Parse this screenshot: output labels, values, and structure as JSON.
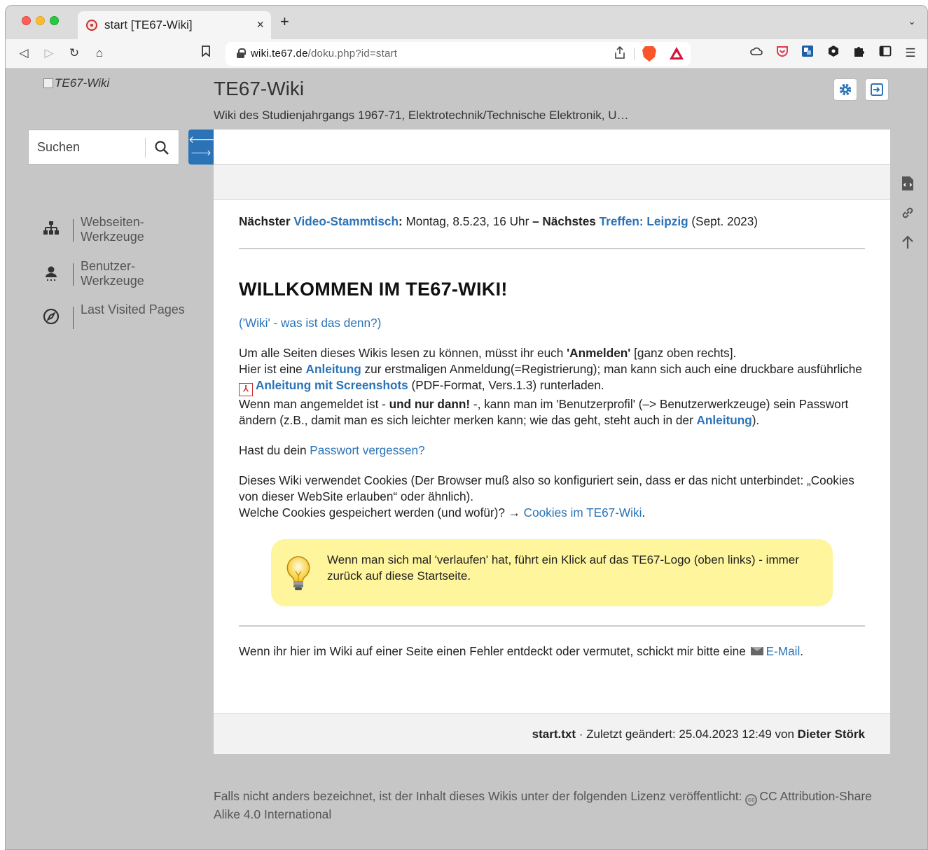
{
  "browser": {
    "tab": {
      "title": "start [TE67-Wiki]",
      "close": "×"
    },
    "new_tab": "+",
    "tab_overflow": "⌄",
    "url": {
      "host": "wiki.te67.de",
      "path": "/doku.php?id=start"
    },
    "icons": [
      "back-icon",
      "forward-icon",
      "reload-icon",
      "home-icon",
      "bookmark-icon",
      "share-icon",
      "brave-shields-icon",
      "brave-rewards-icon",
      "cloud-icon",
      "pocket-icon",
      "extension-icon",
      "puzzle-icon",
      "sidebar-icon",
      "menu-icon"
    ]
  },
  "site": {
    "logo_alt": "TE67-Wiki",
    "title": "TE67-Wiki",
    "tagline": "Wiki des Studienjahrgangs 1967-71, Elektrotechnik/Technische Elektronik, U…"
  },
  "search": {
    "placeholder": "Suchen"
  },
  "sidebar": {
    "items": [
      {
        "label": "Webseiten-Werkzeuge",
        "icon": "sitemap-icon"
      },
      {
        "label": "Benutzer-Werkzeuge",
        "icon": "user-icon"
      },
      {
        "label": "Last Visited Pages",
        "icon": "compass-icon"
      }
    ]
  },
  "news": {
    "b1": "Nächster ",
    "link1": "Video-Stammtisch",
    "b2": ":",
    "t1": " Montag, 8.5.23, 16 Uhr ",
    "b3": "– Nächstes ",
    "link2": "Treffen: Leipzig",
    "t2": " (Sept. 2023)"
  },
  "article": {
    "heading": "WILLKOMMEN IM TE67-WIKI!",
    "wiki_link": "('Wiki' - was ist das denn?)",
    "p1_a": "Um alle Seiten dieses Wikis lesen zu können, müsst ihr euch ",
    "p1_b": "'Anmelden'",
    "p1_c": " [ganz oben rechts].",
    "p1_d": "Hier ist eine ",
    "p1_link1": "Anleitung",
    "p1_e": " zur erstmaligen Anmeldung(=Registrierung); man kann sich auch eine druckbare ausführliche ",
    "p1_pdf": "Anleitung mit Screenshots",
    "p1_f": " (PDF-Format, Vers.1.3) runterladen.",
    "p1_g": "Wenn man angemeldet ist - ",
    "p1_h": "und nur dann!",
    "p1_i": " -, kann man im 'Benutzerprofil' (–> Benutzerwerkzeuge) sein Passwort ändern (z.B., damit man es sich leichter merken kann; wie das geht, steht auch in der ",
    "p1_link2": "Anleitung",
    "p1_j": ").",
    "p2_a": "Hast du dein ",
    "p2_link": "Passwort vergessen?",
    "p3_a": "Dieses Wiki verwendet Cookies (Der Browser muß also so konfiguriert sein, dass er das nicht unterbindet: „Cookies von dieser WebSite erlauben“ oder ähnlich).",
    "p3_b": "Welche Cookies gespeichert werden (und wofür)? → ",
    "p3_link": "Cookies im TE67-Wiki",
    "p3_c": ".",
    "note": "Wenn man sich mal 'verlaufen' hat, führt ein Klick auf das TE67-Logo (oben links) - immer zurück auf diese Startseite.",
    "p4_a": "Wenn ihr hier im Wiki auf einer Seite einen Fehler entdeckt oder vermutet, schickt mir bitte eine ",
    "p4_link": "E-Mail",
    "p4_b": "."
  },
  "footer": {
    "file": "start.txt",
    "changed": " · Zuletzt geändert: 25.04.2023 12:49 von ",
    "author": "Dieter Störk"
  },
  "license": {
    "text": "Falls nicht anders bezeichnet, ist der Inhalt dieses Wikis unter der folgenden Lizenz veröffentlicht: ",
    "link": "CC Attribution-Share Alike 4.0 International"
  },
  "colors": {
    "accent": "#2b73b7",
    "note_bg": "#fff59d",
    "page_bg": "#c6c6c6"
  }
}
